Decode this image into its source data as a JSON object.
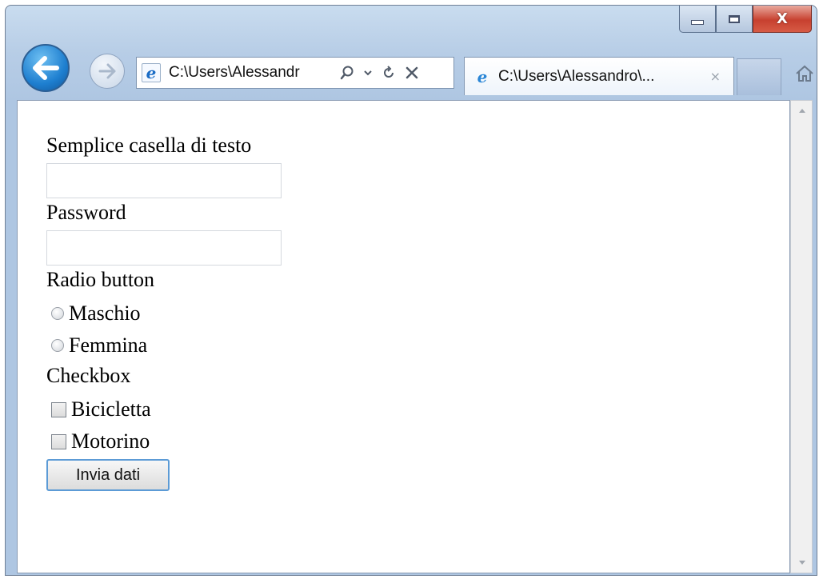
{
  "window": {
    "caption_buttons": {
      "minimize": "minimize",
      "maximize": "maximize",
      "close": "X"
    }
  },
  "navigation": {
    "back_icon": "arrow-left-icon",
    "forward_icon": "arrow-right-icon",
    "address_url": "C:\\Users\\Alessandr",
    "address_tools": {
      "search": "search-icon",
      "dropdown": "chevron-down-icon",
      "refresh": "refresh-icon",
      "stop": "stop-icon"
    }
  },
  "tab": {
    "title": "C:\\Users\\Alessandro\\...",
    "close_glyph": "×"
  },
  "form": {
    "text_label": "Semplice casella di testo",
    "text_value": "",
    "password_label": "Password",
    "password_value": "",
    "radio_label": "Radio button",
    "radio_options": [
      "Maschio",
      "Femmina"
    ],
    "checkbox_label": "Checkbox",
    "checkbox_options": [
      "Bicicletta",
      "Motorino"
    ],
    "submit_label": "Invia dati"
  },
  "colors": {
    "frame": "#b7cde6",
    "close_button": "#c7402f",
    "back_button": "#1e7fd0",
    "submit_border": "#5c9bd6"
  }
}
